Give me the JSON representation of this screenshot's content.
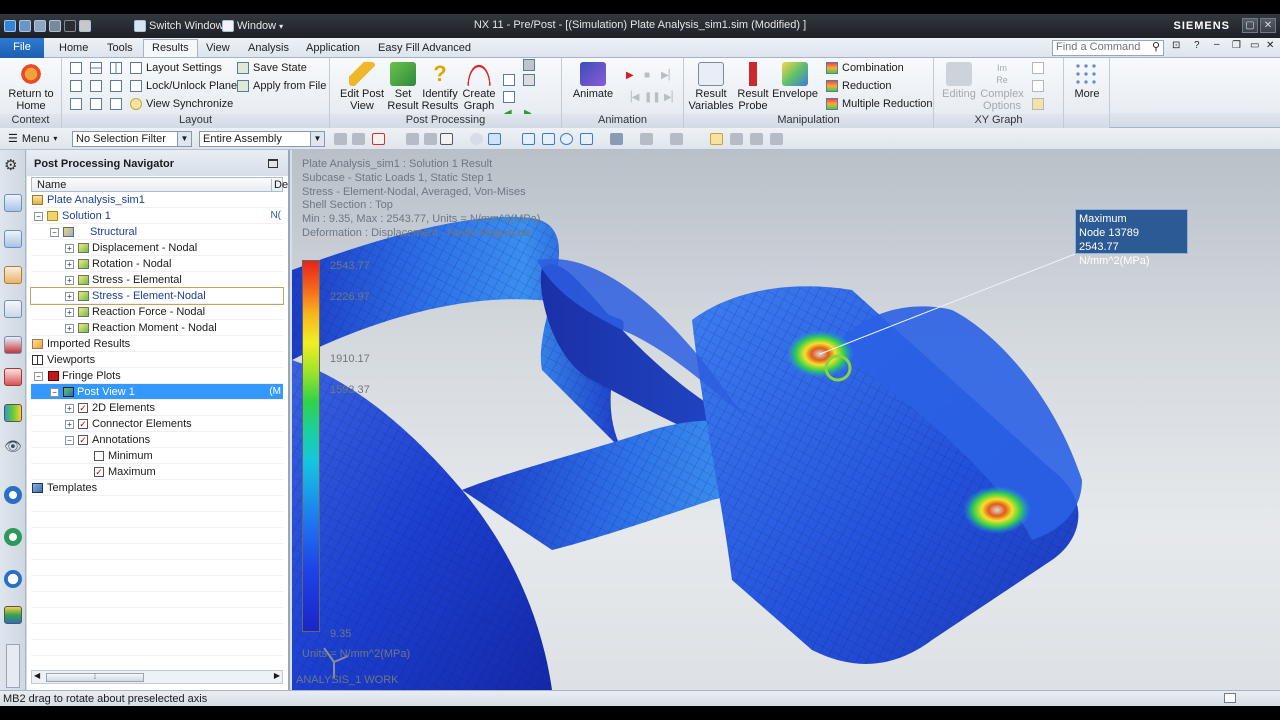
{
  "window": {
    "title": "NX 11 - Pre/Post - [(Simulation) Plate Analysis_sim1.sim (Modified) ]",
    "brand": "SIEMENS",
    "switch_window": "Switch Window",
    "window_menu": "Window"
  },
  "menu": {
    "tabs": [
      "File",
      "Home",
      "Tools",
      "Results",
      "View",
      "Analysis",
      "Application",
      "Easy Fill Advanced"
    ],
    "active": "Results",
    "search_placeholder": "Find a Command"
  },
  "ribbon": {
    "context": {
      "button": "Return to Home",
      "label": "Context"
    },
    "layout": {
      "label": "Layout",
      "items": [
        "Layout Settings",
        "Lock/Unlock Plane",
        "View Synchronize",
        "Save State",
        "Apply from File"
      ]
    },
    "post_processing": {
      "label": "Post Processing",
      "buttons": [
        "Edit Post View",
        "Set Result",
        "Identify Results",
        "Create Graph"
      ]
    },
    "animation": {
      "label": "Animation",
      "button": "Animate"
    },
    "manipulation": {
      "label": "Manipulation",
      "buttons": [
        "Result Variables",
        "Result Probe",
        "Envelope"
      ],
      "items": [
        "Combination",
        "Reduction",
        "Multiple Reduction"
      ]
    },
    "xy_graph": {
      "label": "XY Graph",
      "buttons": [
        "Editing",
        "Complex Options"
      ]
    },
    "more": "More"
  },
  "toolbar": {
    "menu": "Menu",
    "selection_filter": "No Selection Filter",
    "scope": "Entire Assembly"
  },
  "navigator": {
    "title": "Post Processing Navigator",
    "col_name": "Name",
    "col_desc": "De",
    "rows": [
      {
        "label": "Plate Analysis_sim1",
        "desc": ""
      },
      {
        "label": "Solution 1",
        "desc": "N("
      },
      {
        "label": "Structural",
        "desc": ""
      },
      {
        "label": "Displacement - Nodal",
        "desc": ""
      },
      {
        "label": "Rotation - Nodal",
        "desc": ""
      },
      {
        "label": "Stress - Elemental",
        "desc": ""
      },
      {
        "label": "Stress - Element-Nodal",
        "desc": ""
      },
      {
        "label": "Reaction Force - Nodal",
        "desc": ""
      },
      {
        "label": "Reaction Moment - Nodal",
        "desc": ""
      },
      {
        "label": "Imported Results",
        "desc": ""
      },
      {
        "label": "Viewports",
        "desc": ""
      },
      {
        "label": "Fringe Plots",
        "desc": ""
      },
      {
        "label": "Post View 1",
        "desc": "(M"
      },
      {
        "label": "2D Elements",
        "desc": ""
      },
      {
        "label": "Connector Elements",
        "desc": ""
      },
      {
        "label": "Annotations",
        "desc": ""
      },
      {
        "label": "Minimum",
        "desc": ""
      },
      {
        "label": "Maximum",
        "desc": ""
      },
      {
        "label": "Templates",
        "desc": ""
      }
    ]
  },
  "viewport": {
    "info": [
      "Plate Analysis_sim1 : Solution 1 Result",
      "Subcase - Static Loads 1, Static Step 1",
      "Stress - Element-Nodal, Averaged, Von-Mises",
      "Shell Section : Top",
      "Min : 9.35, Max : 2543.77, Units = N/mm^2(MPa)",
      "Deformation : Displacement - Nodal Magnitude"
    ],
    "legend": {
      "top": "2543.77",
      "v2": "2226.97",
      "v3": "1910.17",
      "v4": "1593.37",
      "bottom": "9.35"
    },
    "units": "Units = N/mm^2(MPa)",
    "work_name": "ANALYSIS_1 WORK",
    "max_annotation": {
      "title": "Maximum",
      "node": "Node 13789",
      "value": "2543.77 N/mm^2(MPa)"
    }
  },
  "status": "MB2 drag to rotate about preselected axis"
}
